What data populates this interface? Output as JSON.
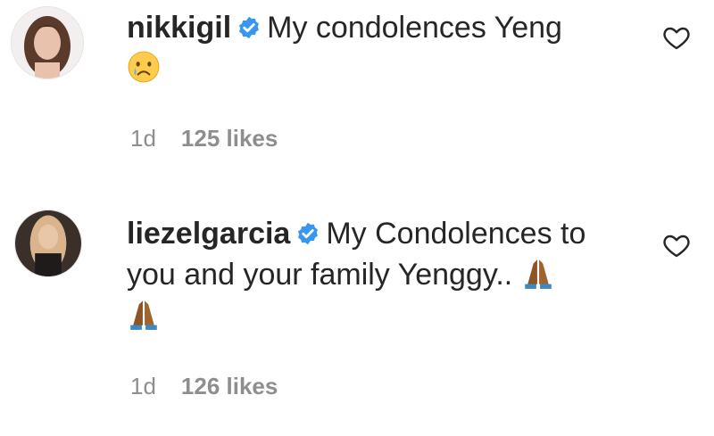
{
  "comments": [
    {
      "username": "nikkigil",
      "text": "My condolences Yeng",
      "emoji_icon": "crying-face-icon",
      "time": "1d",
      "likes": "125 likes"
    },
    {
      "username": "liezelgarcia",
      "text": "My Condolences to you and your family Yenggy..",
      "emoji_icon": "folded-hands-icon",
      "time": "1d",
      "likes": "126 likes"
    }
  ],
  "colors": {
    "text": "#262626",
    "meta": "#8e8e8e",
    "verified": "#3897f0"
  }
}
